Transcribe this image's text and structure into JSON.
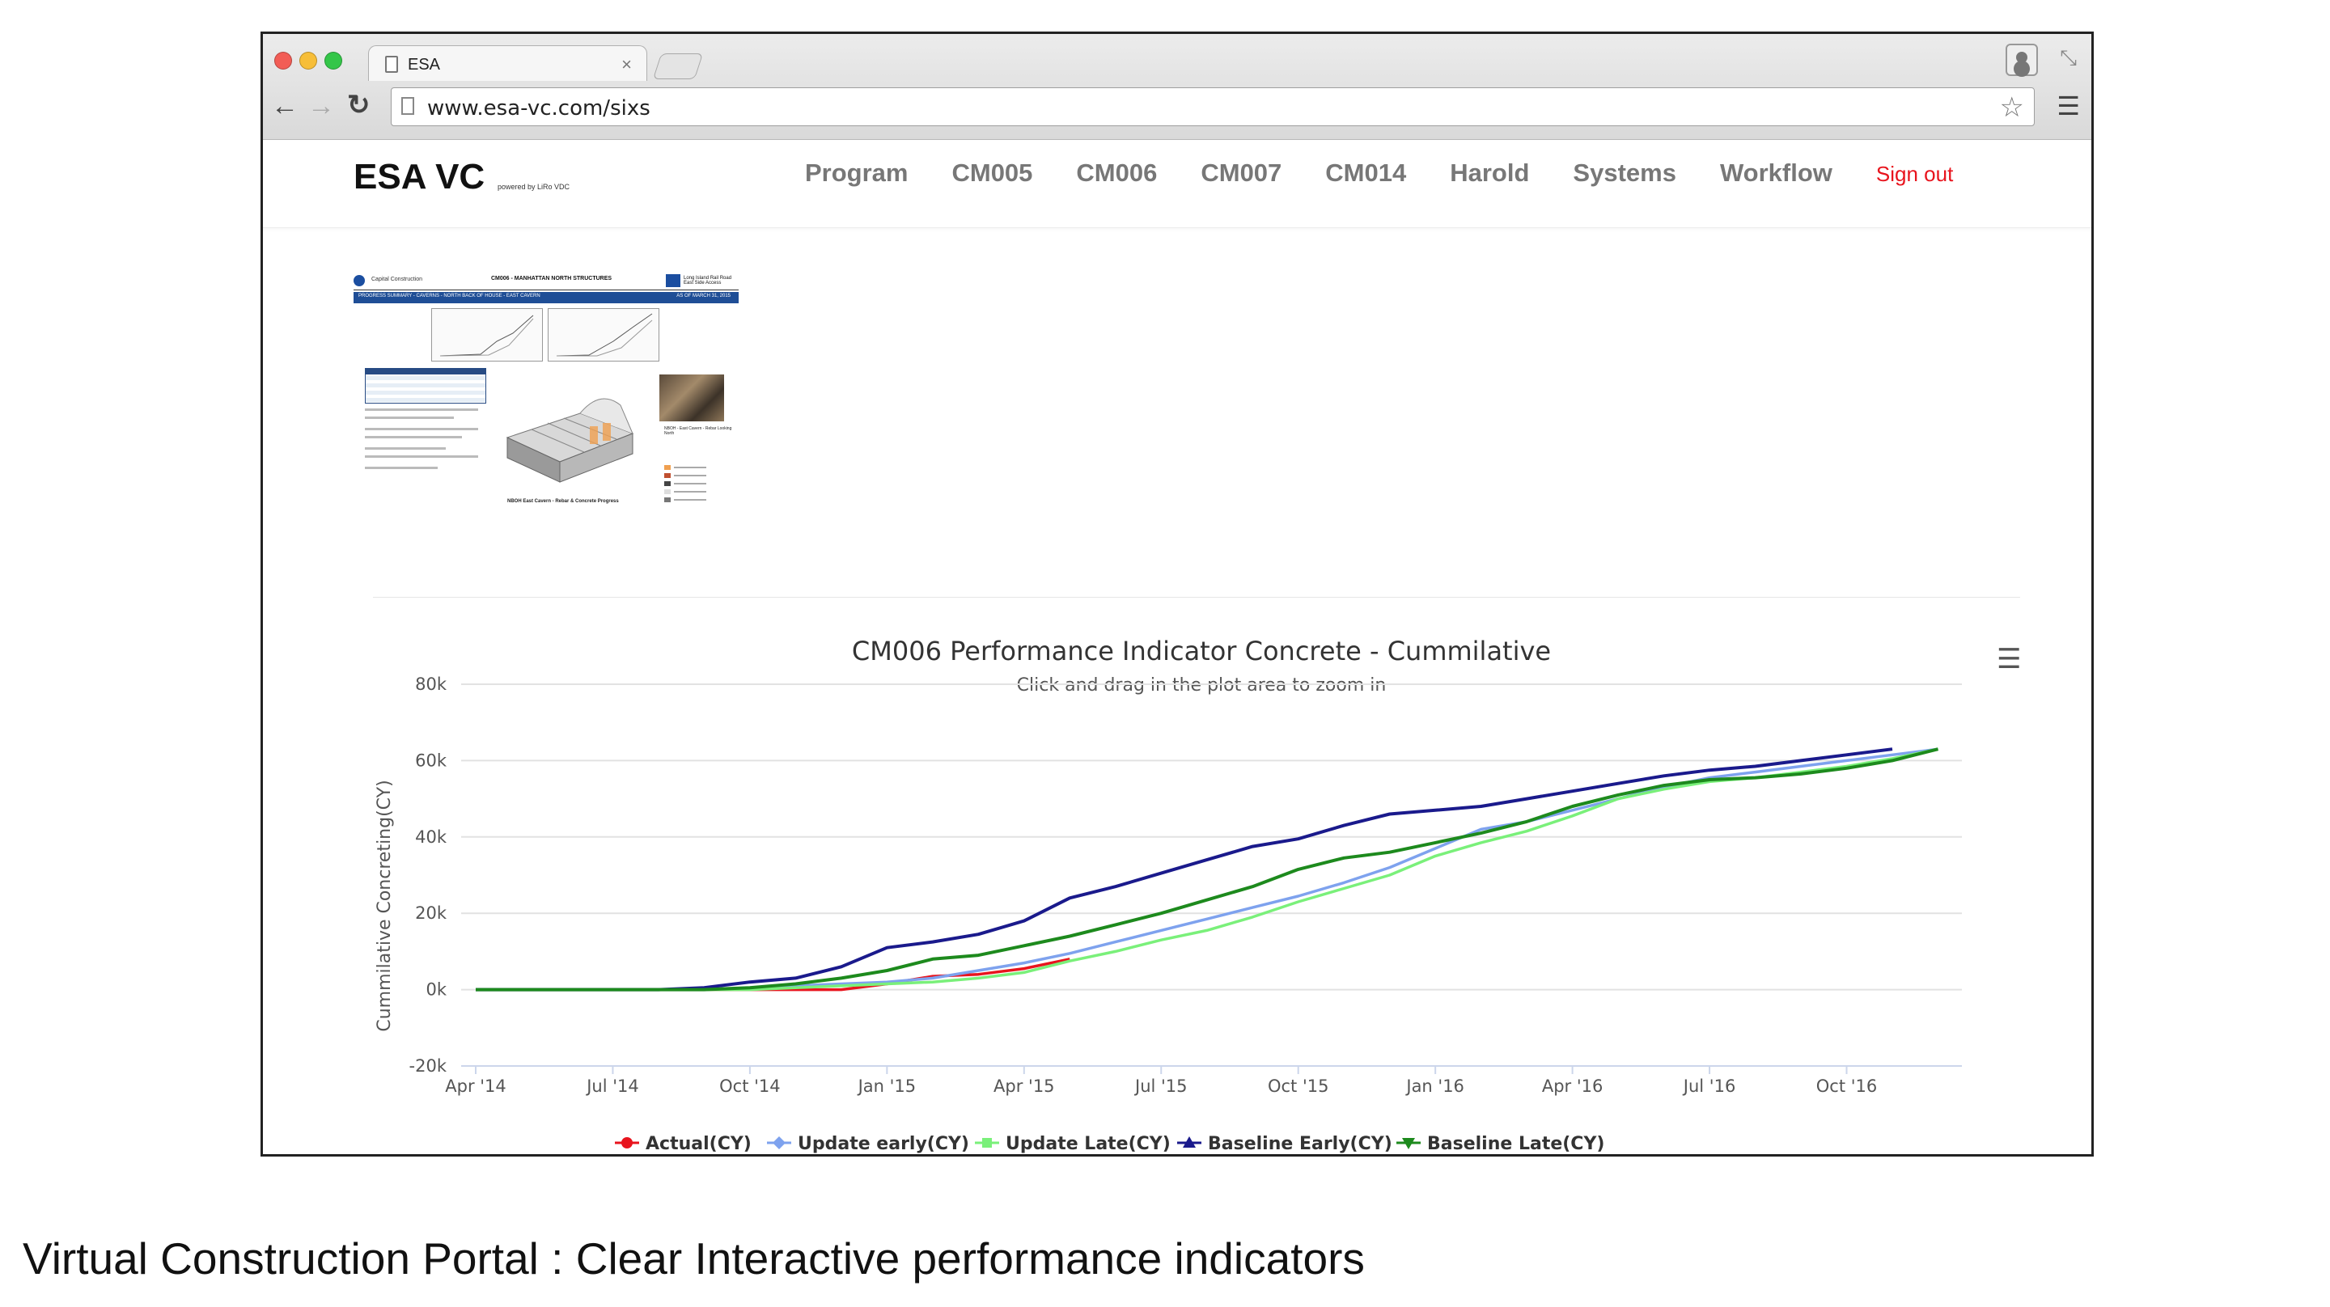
{
  "browser": {
    "tab_title": "ESA",
    "tab_close": "×",
    "url": "www.esa-vc.com/sixs",
    "icons": {
      "back": "back-arrow-icon",
      "forward": "forward-arrow-icon",
      "reload": "reload-icon",
      "star": "bookmark-star-icon",
      "menu": "hamburger-menu-icon",
      "profile": "profile-icon",
      "fullscreen": "fullscreen-icon"
    }
  },
  "site": {
    "brand": "ESA VC",
    "brand_sub": "powered by LiRo VDC",
    "nav": [
      "Program",
      "CM005",
      "CM006",
      "CM007",
      "CM014",
      "Harold",
      "Systems",
      "Workflow"
    ],
    "signout": "Sign out",
    "signout_color": "#e8141d"
  },
  "thumbnail": {
    "org": "Capital Construction",
    "doc_title": "CM006 - MANHATTAN NORTH STRUCTURES",
    "right_title": "Long Island Rail Road East Side Access",
    "bar_left": "PROGRESS SUMMARY - CAVERNS - NORTH BACK OF HOUSE - EAST CAVERN",
    "bar_right": "AS OF MARCH 31, 2015",
    "caption_3d": "NBOH East Cavern - Rebar & Concrete Progress",
    "caption_photo": "NBOH - East Cavern - Rebar Looking North"
  },
  "chart_data": {
    "type": "line",
    "title": "CM006 Performance Indicator Concrete - Cummilative",
    "subtitle": "Click and drag in the plot area to zoom in",
    "ylabel": "Cummilative Concreting(CY)",
    "xlabel": "",
    "ylim": [
      -20000,
      80000
    ],
    "yticks": [
      "80k",
      "60k",
      "40k",
      "20k",
      "0k",
      "-20k"
    ],
    "xticks": [
      "Apr '14",
      "Jul '14",
      "Oct '14",
      "Jan '15",
      "Apr '15",
      "Jul '15",
      "Oct '15",
      "Jan '16",
      "Apr '16",
      "Jul '16",
      "Oct '16"
    ],
    "grid": true,
    "legend_position": "bottom",
    "x": [
      "2014-04",
      "2014-05",
      "2014-06",
      "2014-07",
      "2014-08",
      "2014-09",
      "2014-10",
      "2014-11",
      "2014-12",
      "2015-01",
      "2015-02",
      "2015-03",
      "2015-04",
      "2015-05",
      "2015-06",
      "2015-07",
      "2015-08",
      "2015-09",
      "2015-10",
      "2015-11",
      "2015-12",
      "2016-01",
      "2016-02",
      "2016-03",
      "2016-04",
      "2016-05",
      "2016-06",
      "2016-07",
      "2016-08",
      "2016-09",
      "2016-10",
      "2016-11",
      "2016-12"
    ],
    "series": [
      {
        "name": "Actual(CY)",
        "color": "#e8141d",
        "marker": "circle",
        "values": [
          0,
          0,
          0,
          0,
          0,
          0,
          0,
          0,
          0,
          1500,
          3500,
          4000,
          5500,
          8000,
          null,
          null,
          null,
          null,
          null,
          null,
          null,
          null,
          null,
          null,
          null,
          null,
          null,
          null,
          null,
          null,
          null,
          null,
          null
        ]
      },
      {
        "name": "Update early(CY)",
        "color": "#7ea2ee",
        "marker": "diamond",
        "values": [
          0,
          0,
          0,
          0,
          0,
          0,
          500,
          1000,
          1500,
          2000,
          3000,
          5000,
          7000,
          9500,
          12500,
          15500,
          18500,
          21500,
          24500,
          28000,
          32000,
          37000,
          42000,
          44000,
          47000,
          50000,
          53000,
          55500,
          57000,
          58500,
          60000,
          61500,
          63000
        ]
      },
      {
        "name": "Update Late(CY)",
        "color": "#7af07a",
        "marker": "square",
        "values": [
          0,
          0,
          0,
          0,
          0,
          0,
          0,
          500,
          1000,
          1500,
          2000,
          3000,
          4500,
          7500,
          10000,
          13000,
          15500,
          19000,
          23000,
          26500,
          30000,
          35000,
          38500,
          41500,
          45500,
          50000,
          52500,
          54500,
          55500,
          57000,
          58500,
          60500,
          63000
        ]
      },
      {
        "name": "Baseline Early(CY)",
        "color": "#1a1a8c",
        "marker": "triangle",
        "values": [
          0,
          0,
          0,
          0,
          0,
          500,
          2000,
          3000,
          6000,
          11000,
          12500,
          14500,
          18000,
          24000,
          27000,
          30500,
          34000,
          37500,
          39500,
          43000,
          46000,
          47000,
          48000,
          50000,
          52000,
          54000,
          56000,
          57500,
          58500,
          60000,
          61500,
          63000,
          null
        ]
      },
      {
        "name": "Baseline Late(CY)",
        "color": "#1d8a1d",
        "marker": "triangle-down",
        "values": [
          0,
          0,
          0,
          0,
          0,
          0,
          500,
          1500,
          3000,
          5000,
          8000,
          9000,
          11500,
          14000,
          17000,
          20000,
          23500,
          27000,
          31500,
          34500,
          36000,
          38500,
          41000,
          44000,
          48000,
          51000,
          53500,
          55000,
          55500,
          56500,
          58000,
          60000,
          63000
        ]
      }
    ]
  },
  "chart_ui": {
    "menu_icon": "chart-context-menu-icon"
  },
  "caption": "Virtual Construction Portal : Clear Interactive performance indicators"
}
